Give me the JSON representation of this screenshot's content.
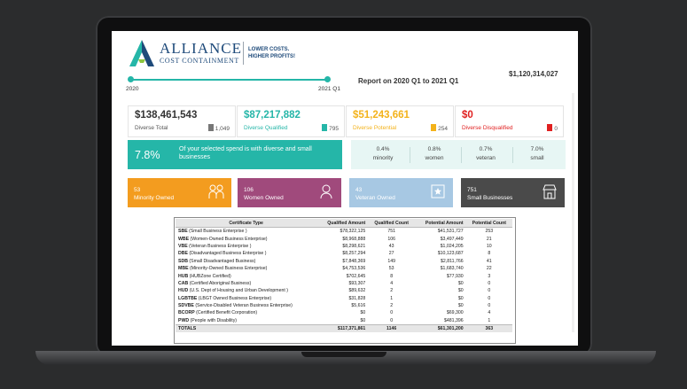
{
  "header": {
    "logo_title": "ALLIANCE",
    "logo_subtitle": "COST CONTAINMENT",
    "tagline_line1": "LOWER COSTS.",
    "tagline_line2": "HIGHER PROFITS!",
    "brand_color": "#1e4a7a",
    "accent_color": "#25b6a8"
  },
  "timeline": {
    "start_label": "2020",
    "end_label": "2021 Q1"
  },
  "report_title": "Report on 2020 Q1 to 2021 Q1",
  "top_amount": "$1,120,314,027",
  "cards": [
    {
      "amount": "$138,461,543",
      "label": "Diverse Total",
      "count": "1,049",
      "color": "#333333"
    },
    {
      "amount": "$87,217,882",
      "label": "Diverse Qualified",
      "count": "795",
      "color": "#25b6a8"
    },
    {
      "amount": "$51,243,661",
      "label": "Diverse Potential",
      "count": "254",
      "color": "#f3b21a"
    },
    {
      "amount": "$0",
      "label": "Diverse Disqualified",
      "count": "0",
      "color": "#e02020"
    }
  ],
  "banner": {
    "percent": "7.8%",
    "text": "Of your selected spend is with diverse and small businesses"
  },
  "stats": [
    {
      "value": "0.4%",
      "label": "minority"
    },
    {
      "value": "0.8%",
      "label": "women"
    },
    {
      "value": "0.7%",
      "label": "veteran"
    },
    {
      "value": "7.0%",
      "label": "small"
    }
  ],
  "categories": [
    {
      "count": "53",
      "label": "Minority Owned",
      "color": "#f39c1f",
      "icon": "people-icon"
    },
    {
      "count": "106",
      "label": "Women Owned",
      "color": "#a04a7c",
      "icon": "woman-icon"
    },
    {
      "count": "43",
      "label": "Veteran Owned",
      "color": "#a7c8e3",
      "icon": "veteran-icon"
    },
    {
      "count": "751",
      "label": "Small Businesses",
      "color": "#4a4a4a",
      "icon": "store-icon"
    }
  ],
  "table": {
    "headers": [
      "Certificate Type",
      "Qualified Amount",
      "Qualified Count",
      "Potential Amount",
      "Potential Count"
    ],
    "rows": [
      [
        "SBE (Small Business Enterprise )",
        "$78,322,125",
        "751",
        "$41,531,727",
        "253"
      ],
      [
        "WBE (Women-Owned Business Enterprise)",
        "$8,968,888",
        "106",
        "$3,497,449",
        "21"
      ],
      [
        "VBE (Veteran Business Enterprise )",
        "$8,298,621",
        "43",
        "$1,024,205",
        "10"
      ],
      [
        "DBE (Disadvantaged Business Enterprise )",
        "$8,257,294",
        "27",
        "$10,123,687",
        "8"
      ],
      [
        "SDB (Small Disadvantaged Business)",
        "$7,848,369",
        "149",
        "$2,811,766",
        "41"
      ],
      [
        "MBE (Minority-Owned Business Enterprise)",
        "$4,753,536",
        "53",
        "$1,683,740",
        "22"
      ],
      [
        "HUB (HUBZone Certified)",
        "$702,645",
        "8",
        "$77,930",
        "3"
      ],
      [
        "CAB (Certified Aboriginal Business)",
        "$93,307",
        "4",
        "$0",
        "0"
      ],
      [
        "HUD (U.S. Dept of Housing and Urban Development )",
        "$89,632",
        "2",
        "$0",
        "0"
      ],
      [
        "LGBTBE (LBGT Owned Business Enterprise)",
        "$31,828",
        "1",
        "$0",
        "0"
      ],
      [
        "SDVBE (Service-Disabled Veteran Business Enterprise)",
        "$5,616",
        "2",
        "$0",
        "0"
      ],
      [
        "BCORP (Certified Benefit Corporation)",
        "$0",
        "0",
        "$69,300",
        "4"
      ],
      [
        "PWD (People with Disability)",
        "$0",
        "0",
        "$481,396",
        "1"
      ]
    ],
    "totals": [
      "TOTALS",
      "$117,371,861",
      "1146",
      "$61,301,200",
      "363"
    ]
  }
}
